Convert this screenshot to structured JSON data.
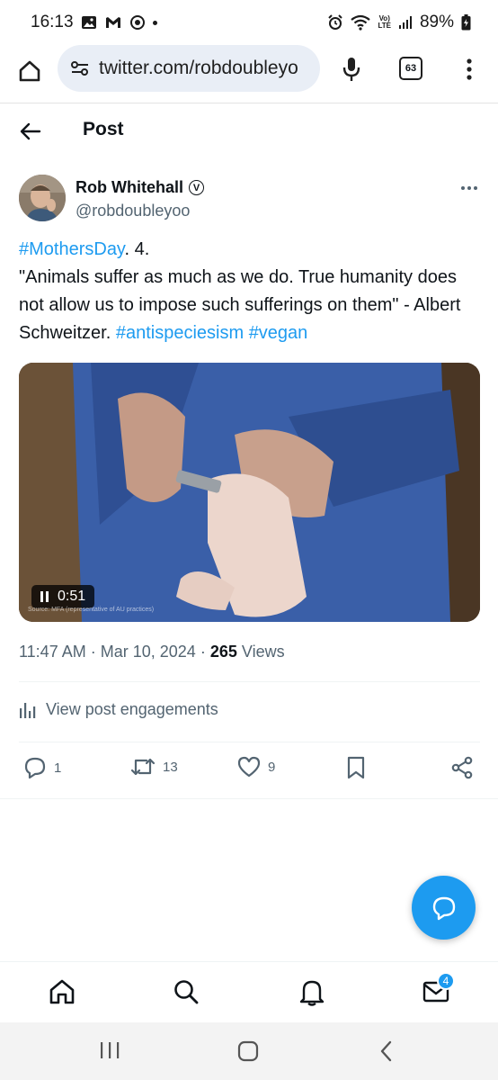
{
  "status_bar": {
    "time": "16:13",
    "battery": "89%",
    "lte_label": "Vo)\nLTE"
  },
  "browser": {
    "url": "twitter.com/robdoubleyo",
    "tab_count": "63"
  },
  "header": {
    "title": "Post"
  },
  "post": {
    "author_name": "Rob Whitehall",
    "author_badge": "V",
    "author_handle": "@robdoubleyoo",
    "hashtag_mothersday": "#MothersDay",
    "text_after_hashtag": ". 4.",
    "quote_text": "\"Animals suffer as much as we do. True humanity does not allow us to impose such sufferings on them\" - Albert Schweitzer. ",
    "hashtag_antispeciesism": "#antispeciesism",
    "hashtag_vegan": "#vegan",
    "video_duration": "0:51",
    "video_source": "Source: MFA (representative of AU practices)",
    "time": "11:47 AM",
    "date": "Mar 10, 2024",
    "separator": "·",
    "views_count": "265",
    "views_label": "Views",
    "engagements_label": "View post engagements"
  },
  "actions": {
    "replies": "1",
    "reposts": "13",
    "likes": "9"
  },
  "bottom_nav": {
    "messages_badge": "4"
  },
  "colors": {
    "accent": "#1d9bf0",
    "text": "#0f1419",
    "muted": "#536471"
  }
}
